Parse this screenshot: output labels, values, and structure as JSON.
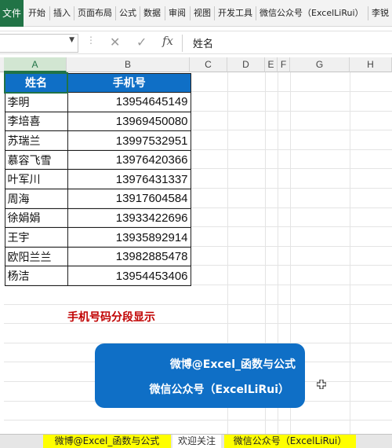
{
  "ribbon": {
    "file_tab": "文件",
    "tabs": [
      "开始",
      "插入",
      "页面布局",
      "公式",
      "数据",
      "审阅",
      "视图",
      "开发工具",
      "微信公众号（ExcelLiRui）",
      "李锐"
    ]
  },
  "formula_bar": {
    "name_box": "",
    "cancel_glyph": "✕",
    "enter_glyph": "✓",
    "fx_label": "fx",
    "content": "姓名"
  },
  "columns": [
    "A",
    "B",
    "C",
    "D",
    "E",
    "F",
    "G",
    "H"
  ],
  "selected_column": "A",
  "table": {
    "headers": [
      "姓名",
      "手机号"
    ],
    "rows": [
      [
        "李明",
        "13954645149"
      ],
      [
        "李培喜",
        "13969450080"
      ],
      [
        "苏瑞兰",
        "13997532951"
      ],
      [
        "慕容飞雪",
        "13976420366"
      ],
      [
        "叶军川",
        "13976431337"
      ],
      [
        "周海",
        "13917604584"
      ],
      [
        "徐娟娟",
        "13933422696"
      ],
      [
        "王宇",
        "13935892914"
      ],
      [
        "欧阳兰兰",
        "13982885478"
      ],
      [
        "杨洁",
        "13954453406"
      ]
    ]
  },
  "caption": "手机号码分段显示",
  "info_box": {
    "line1": "微博@Excel_函数与公式",
    "line2": "微信公众号（ExcelLiRui）"
  },
  "sheet_tabs": [
    "微博@Excel_函数与公式",
    "欢迎关注",
    "微信公众号（ExcelLiRui）"
  ],
  "colors": {
    "header_blue": "#0f6fc6",
    "excel_green": "#217346",
    "caption_red": "#c00000",
    "tab_yellow": "#ffff00"
  }
}
